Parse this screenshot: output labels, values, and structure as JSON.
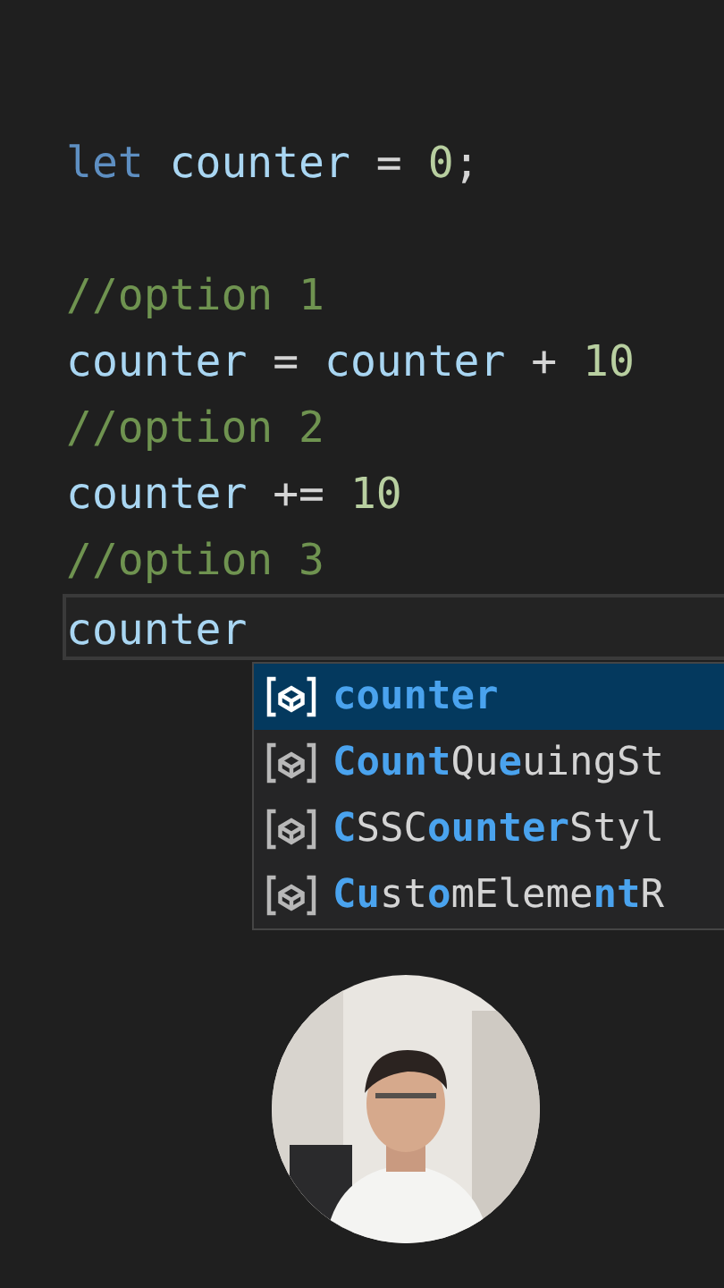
{
  "editor": {
    "lines": [
      {
        "kind": "code",
        "current": false,
        "tokens": [
          {
            "kind": "keyword",
            "text": "let "
          },
          {
            "kind": "variable",
            "text": "counter"
          },
          {
            "kind": "operator",
            "text": " = "
          },
          {
            "kind": "number",
            "text": "0"
          },
          {
            "kind": "operator",
            "text": ";"
          }
        ]
      },
      {
        "kind": "blank",
        "current": false
      },
      {
        "kind": "code",
        "current": false,
        "tokens": [
          {
            "kind": "comment",
            "text": "//option 1"
          }
        ]
      },
      {
        "kind": "code",
        "current": false,
        "tokens": [
          {
            "kind": "variable",
            "text": "counter"
          },
          {
            "kind": "operator",
            "text": " = "
          },
          {
            "kind": "variable",
            "text": "counter"
          },
          {
            "kind": "operator",
            "text": " + "
          },
          {
            "kind": "number",
            "text": "10"
          }
        ]
      },
      {
        "kind": "code",
        "current": false,
        "tokens": [
          {
            "kind": "comment",
            "text": "//option 2"
          }
        ]
      },
      {
        "kind": "code",
        "current": false,
        "tokens": [
          {
            "kind": "variable",
            "text": "counter"
          },
          {
            "kind": "operator",
            "text": " += "
          },
          {
            "kind": "number",
            "text": "10"
          }
        ]
      },
      {
        "kind": "code",
        "current": false,
        "tokens": [
          {
            "kind": "comment",
            "text": "//option 3"
          }
        ]
      },
      {
        "kind": "code",
        "current": true,
        "tokens": [
          {
            "kind": "variable",
            "text": "counter"
          }
        ]
      }
    ]
  },
  "suggestions": [
    {
      "label": "counter",
      "selected": true
    },
    {
      "label": "**Count**Qu**e**uingSt",
      "selected": false
    },
    {
      "label": "**C**SSC**ounter**Styl",
      "selected": false
    },
    {
      "label": "**Cu**st**o**mEleme**nt**R",
      "selected": false
    }
  ]
}
